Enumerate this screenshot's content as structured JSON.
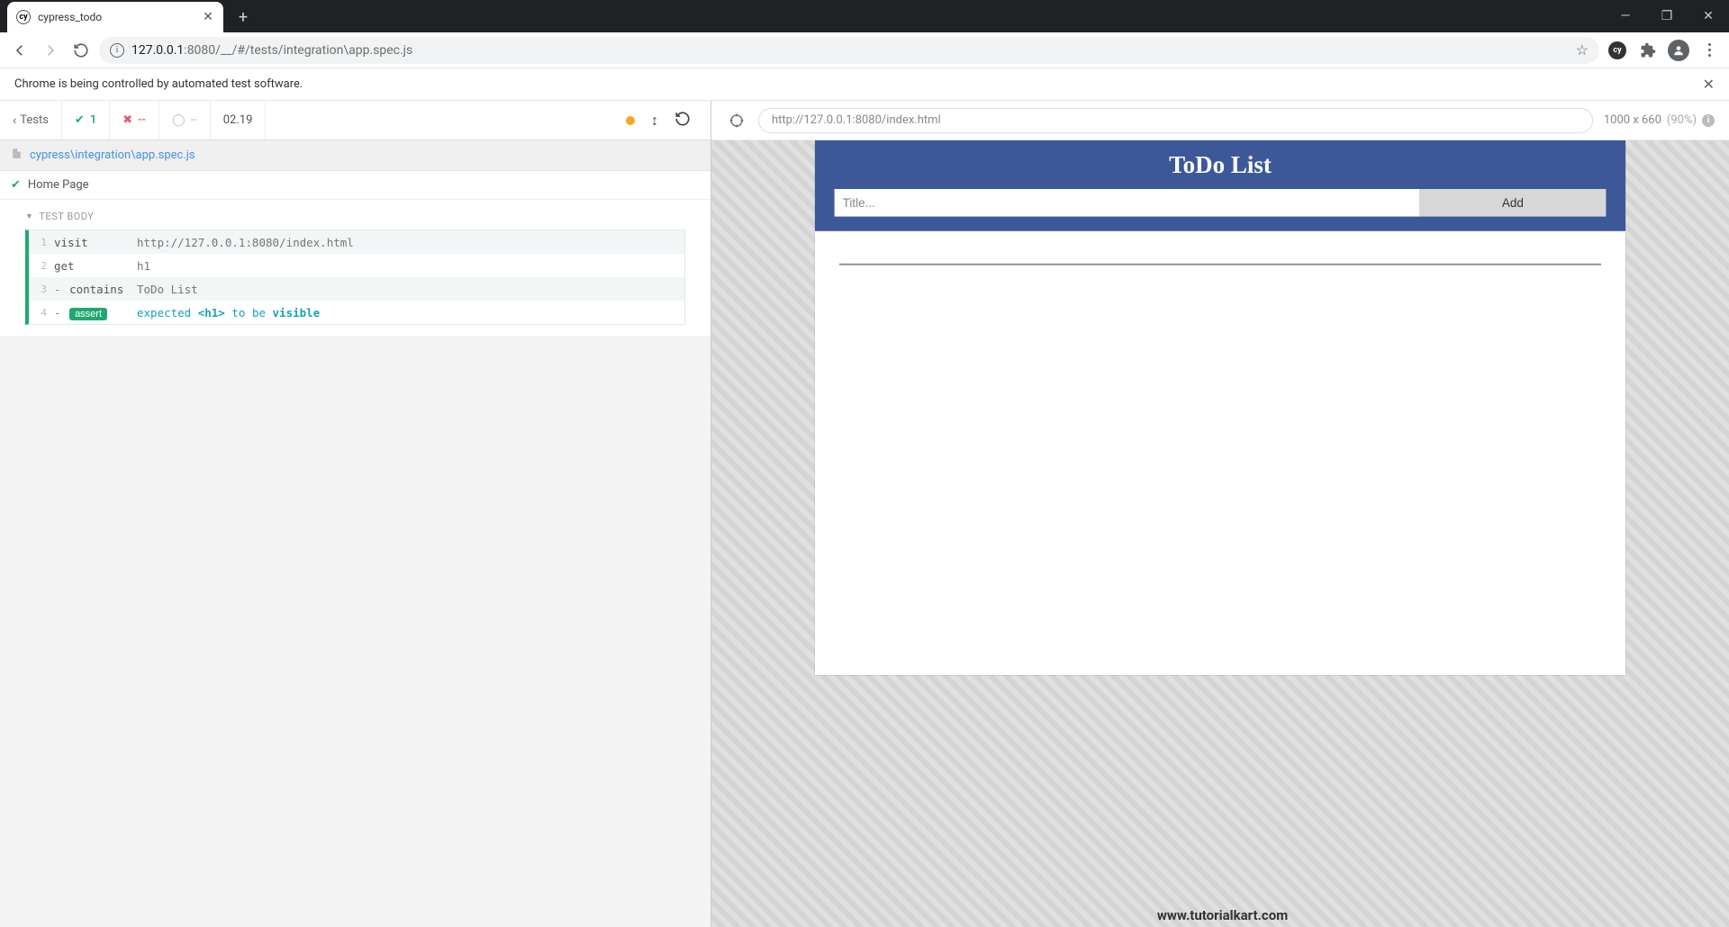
{
  "browser": {
    "tab_title": "cypress_todo",
    "url_ip": "127.0.0.1",
    "url_port": ":8080",
    "url_path": "/__/#/tests/integration\\app.spec.js",
    "infobar_message": "Chrome is being controlled by automated test software."
  },
  "reporter": {
    "tests_label": "Tests",
    "pass_count": "1",
    "fail_count": "--",
    "pending_count": "--",
    "duration": "02.19",
    "spec_file": "cypress\\integration\\app.spec.js",
    "test_name": "Home Page",
    "body_label": "TEST BODY",
    "commands": [
      {
        "num": "1",
        "name": "visit",
        "prefix": "",
        "msg_plain": "http://127.0.0.1:8080/index.html"
      },
      {
        "num": "2",
        "name": "get",
        "prefix": "",
        "msg_plain": "h1"
      },
      {
        "num": "3",
        "name": "contains",
        "prefix": "- ",
        "msg_plain": "ToDo List"
      },
      {
        "num": "4",
        "name": "assert",
        "prefix": "- ",
        "assert_badge": true,
        "msg_parts": [
          "expected ",
          "<h1>",
          " to be ",
          "visible"
        ]
      }
    ]
  },
  "aut": {
    "url": "http://127.0.0.1:8080/index.html",
    "viewport_size": "1000 x 660",
    "viewport_scale": "(90%)"
  },
  "todo_app": {
    "heading": "ToDo List",
    "input_placeholder": "Title...",
    "add_label": "Add"
  },
  "watermark": "www.tutorialkart.com"
}
